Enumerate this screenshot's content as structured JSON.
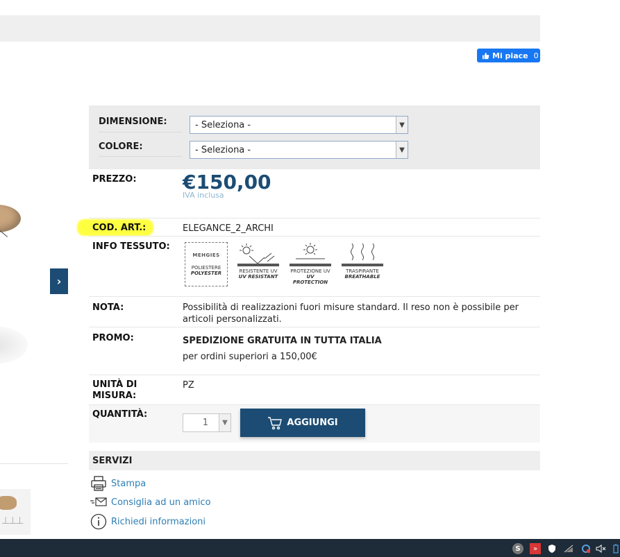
{
  "facebook": {
    "like_label": "Mi piace",
    "like_count": "0",
    "icon": "thumbs-up-icon"
  },
  "gallery": {
    "next_arrow": "›"
  },
  "options": {
    "dimensione_label": "DIMENSIONE:",
    "dimensione_value": "- Seleziona -",
    "colore_label": "COLORE:",
    "colore_value": "- Seleziona -"
  },
  "product": {
    "prezzo_label": "PREZZO:",
    "price": "€150,00",
    "iva": "IVA inclusa",
    "cod_label": "COD. ART.:",
    "cod_value": "ELEGANCE_2_ARCHI",
    "info_label": "INFO TESSUTO:",
    "fabric": [
      {
        "brand": "MEHGIES",
        "caption1": "POLIESTERE",
        "caption2": "POLYESTER",
        "icon": "polyester-badge-icon"
      },
      {
        "caption1": "RESISTENTE UV",
        "caption2": "UV RESISTANT",
        "icon": "uv-resistant-icon"
      },
      {
        "caption1": "PROTEZIONE UV",
        "caption2": "UV PROTECTION",
        "icon": "uv-protection-icon"
      },
      {
        "caption1": "TRASPIRANTE",
        "caption2": "BREATHABLE",
        "icon": "breathable-icon"
      }
    ],
    "nota_label": "NOTA:",
    "nota_value": "Possibilità di realizzazioni fuori misure standard. Il reso non è possibile per articoli personalizzati.",
    "promo_label": "PROMO:",
    "promo_title": "SPEDIZIONE GRATUITA IN TUTTA ITALIA",
    "promo_sub": "per ordini superiori a 150,00€",
    "unita_label": "UNITÀ DI MISURA:",
    "unita_value": "PZ",
    "quantita_label": "QUANTITÀ:",
    "quantita_value": "1",
    "add_label": "AGGIUNGI"
  },
  "servizi": {
    "title": "SERVIZI",
    "items": [
      {
        "label": "Stampa",
        "icon": "printer-icon"
      },
      {
        "label": "Consiglia ad un amico",
        "icon": "email-icon"
      },
      {
        "label": "Richiedi informazioni",
        "icon": "info-icon"
      }
    ]
  },
  "colors": {
    "accent": "#1c4c73",
    "link": "#2d7fb5",
    "highlight": "#ffff2e",
    "facebook": "#1877f2"
  }
}
